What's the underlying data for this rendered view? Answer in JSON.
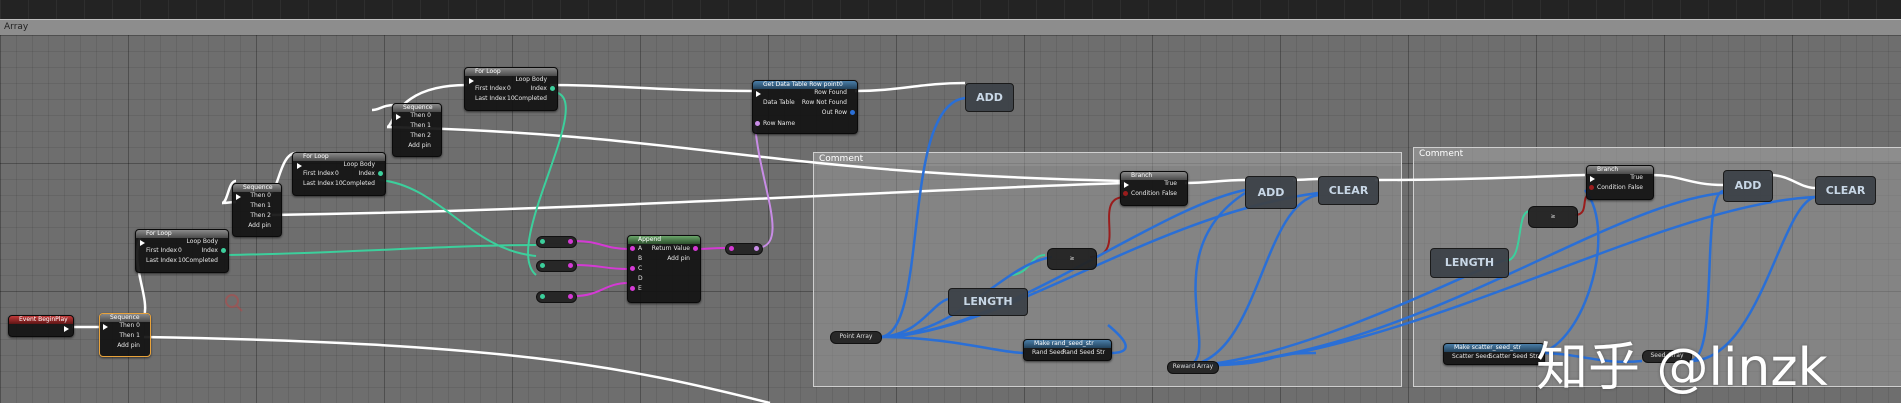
{
  "window": {
    "title": "Array"
  },
  "comments": [
    {
      "label": "Comment"
    },
    {
      "label": "Comment"
    }
  ],
  "nodes": {
    "event_begin_play": {
      "title": "Event BeginPlay"
    },
    "sequence_1": {
      "title": "Sequence",
      "pins": [
        "Then 0",
        "Then 1",
        "Add pin"
      ]
    },
    "for_loop_1": {
      "title": "For Loop",
      "pins": [
        "Loop Body",
        "First Index",
        "Index",
        "Last Index",
        "Completed"
      ],
      "first_index": "0",
      "last_index": "10"
    },
    "sequence_2": {
      "title": "Sequence",
      "pins": [
        "Then 0",
        "Then 1",
        "Then 2",
        "Add pin"
      ]
    },
    "for_loop_2": {
      "title": "For Loop",
      "pins": [
        "Loop Body",
        "First Index",
        "Index",
        "Last Index",
        "Completed"
      ],
      "first_index": "0",
      "last_index": "10"
    },
    "sequence_3": {
      "title": "Sequence",
      "pins": [
        "Then 0",
        "Then 1",
        "Then 2",
        "Add pin"
      ]
    },
    "for_loop_3": {
      "title": "For Loop",
      "pins": [
        "Loop Body",
        "First Index",
        "Index",
        "Last Index",
        "Completed"
      ],
      "first_index": "0",
      "last_index": "10"
    },
    "get_data_table_row": {
      "title": "Get Data Table Row point0",
      "pins": [
        "Row Found",
        "Data Table",
        "Row Not Found",
        "Out Row",
        "Row Name"
      ]
    },
    "append": {
      "title": "Append",
      "pins": [
        "A",
        "Return Value",
        "B",
        "Add pin",
        "C",
        "D",
        "E"
      ]
    },
    "add_1": {
      "label": "ADD"
    },
    "length_1": {
      "label": "LENGTH"
    },
    "branch_1": {
      "title": "Branch",
      "pins": [
        "True",
        "Condition",
        "False"
      ]
    },
    "add_2": {
      "label": "ADD"
    },
    "clear_1": {
      "label": "CLEAR"
    },
    "point_array": {
      "label": "Point Array"
    },
    "make_rand_seed": {
      "title": "Make rand_seed_str",
      "pins": [
        "Rand Seed",
        "Rand Seed Str"
      ]
    },
    "reward_array": {
      "label": "Reward Array"
    },
    "length_2": {
      "label": "LENGTH"
    },
    "branch_2": {
      "title": "Branch",
      "pins": [
        "True",
        "Condition",
        "False"
      ]
    },
    "add_3": {
      "label": "ADD"
    },
    "clear_2": {
      "label": "CLEAR"
    },
    "make_scatter_seed": {
      "title": "Make scatter_seed_str",
      "pins": [
        "Scatter Seed",
        "Scatter Seed Str"
      ]
    },
    "seed_array": {
      "label": "Seed Array"
    }
  },
  "watermark": "知乎 @linzk",
  "colors": {
    "exec_wire": "#ffffff",
    "int_wire": "#3ccf9c",
    "array_wire": "#2a6fd6",
    "string_wire": "#d43ad4",
    "name_wire": "#c88ce6",
    "bool_wire": "#8a1a1a",
    "graph_bg": "#6e6e6e"
  }
}
